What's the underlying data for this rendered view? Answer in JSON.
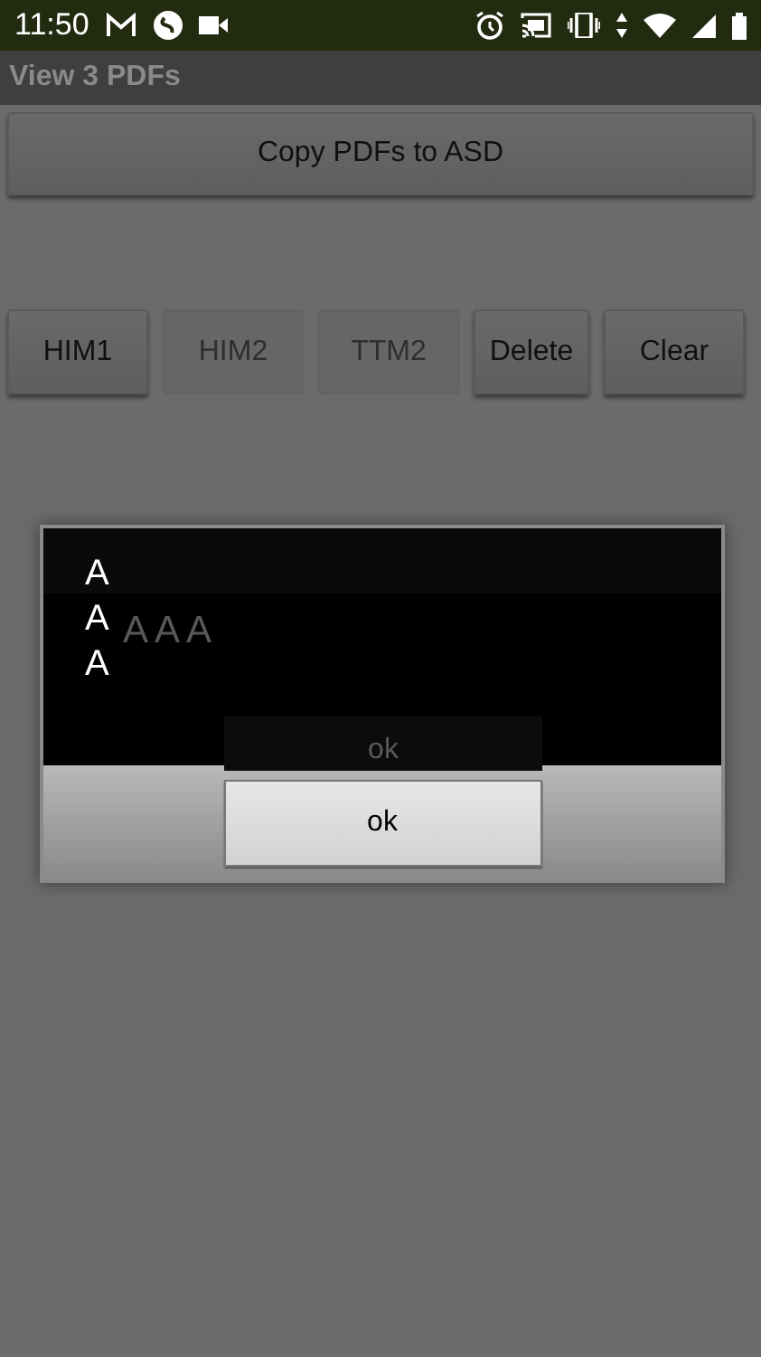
{
  "status_bar": {
    "time": "11:50"
  },
  "app_bar": {
    "title": "View 3 PDFs"
  },
  "copy_button": {
    "label": "Copy PDFs to ASD",
    "disabled": false
  },
  "buttons": [
    {
      "label": "HIM1",
      "disabled": false
    },
    {
      "label": "HIM2",
      "disabled": true
    },
    {
      "label": "TTM2",
      "disabled": true
    },
    {
      "label": "Delete",
      "disabled": false
    },
    {
      "label": "Clear",
      "disabled": false
    }
  ],
  "background_dialog": {
    "message": "A A A",
    "button": "ok"
  },
  "dialog": {
    "lines": [
      "A",
      "A",
      "A"
    ],
    "button": "ok"
  }
}
